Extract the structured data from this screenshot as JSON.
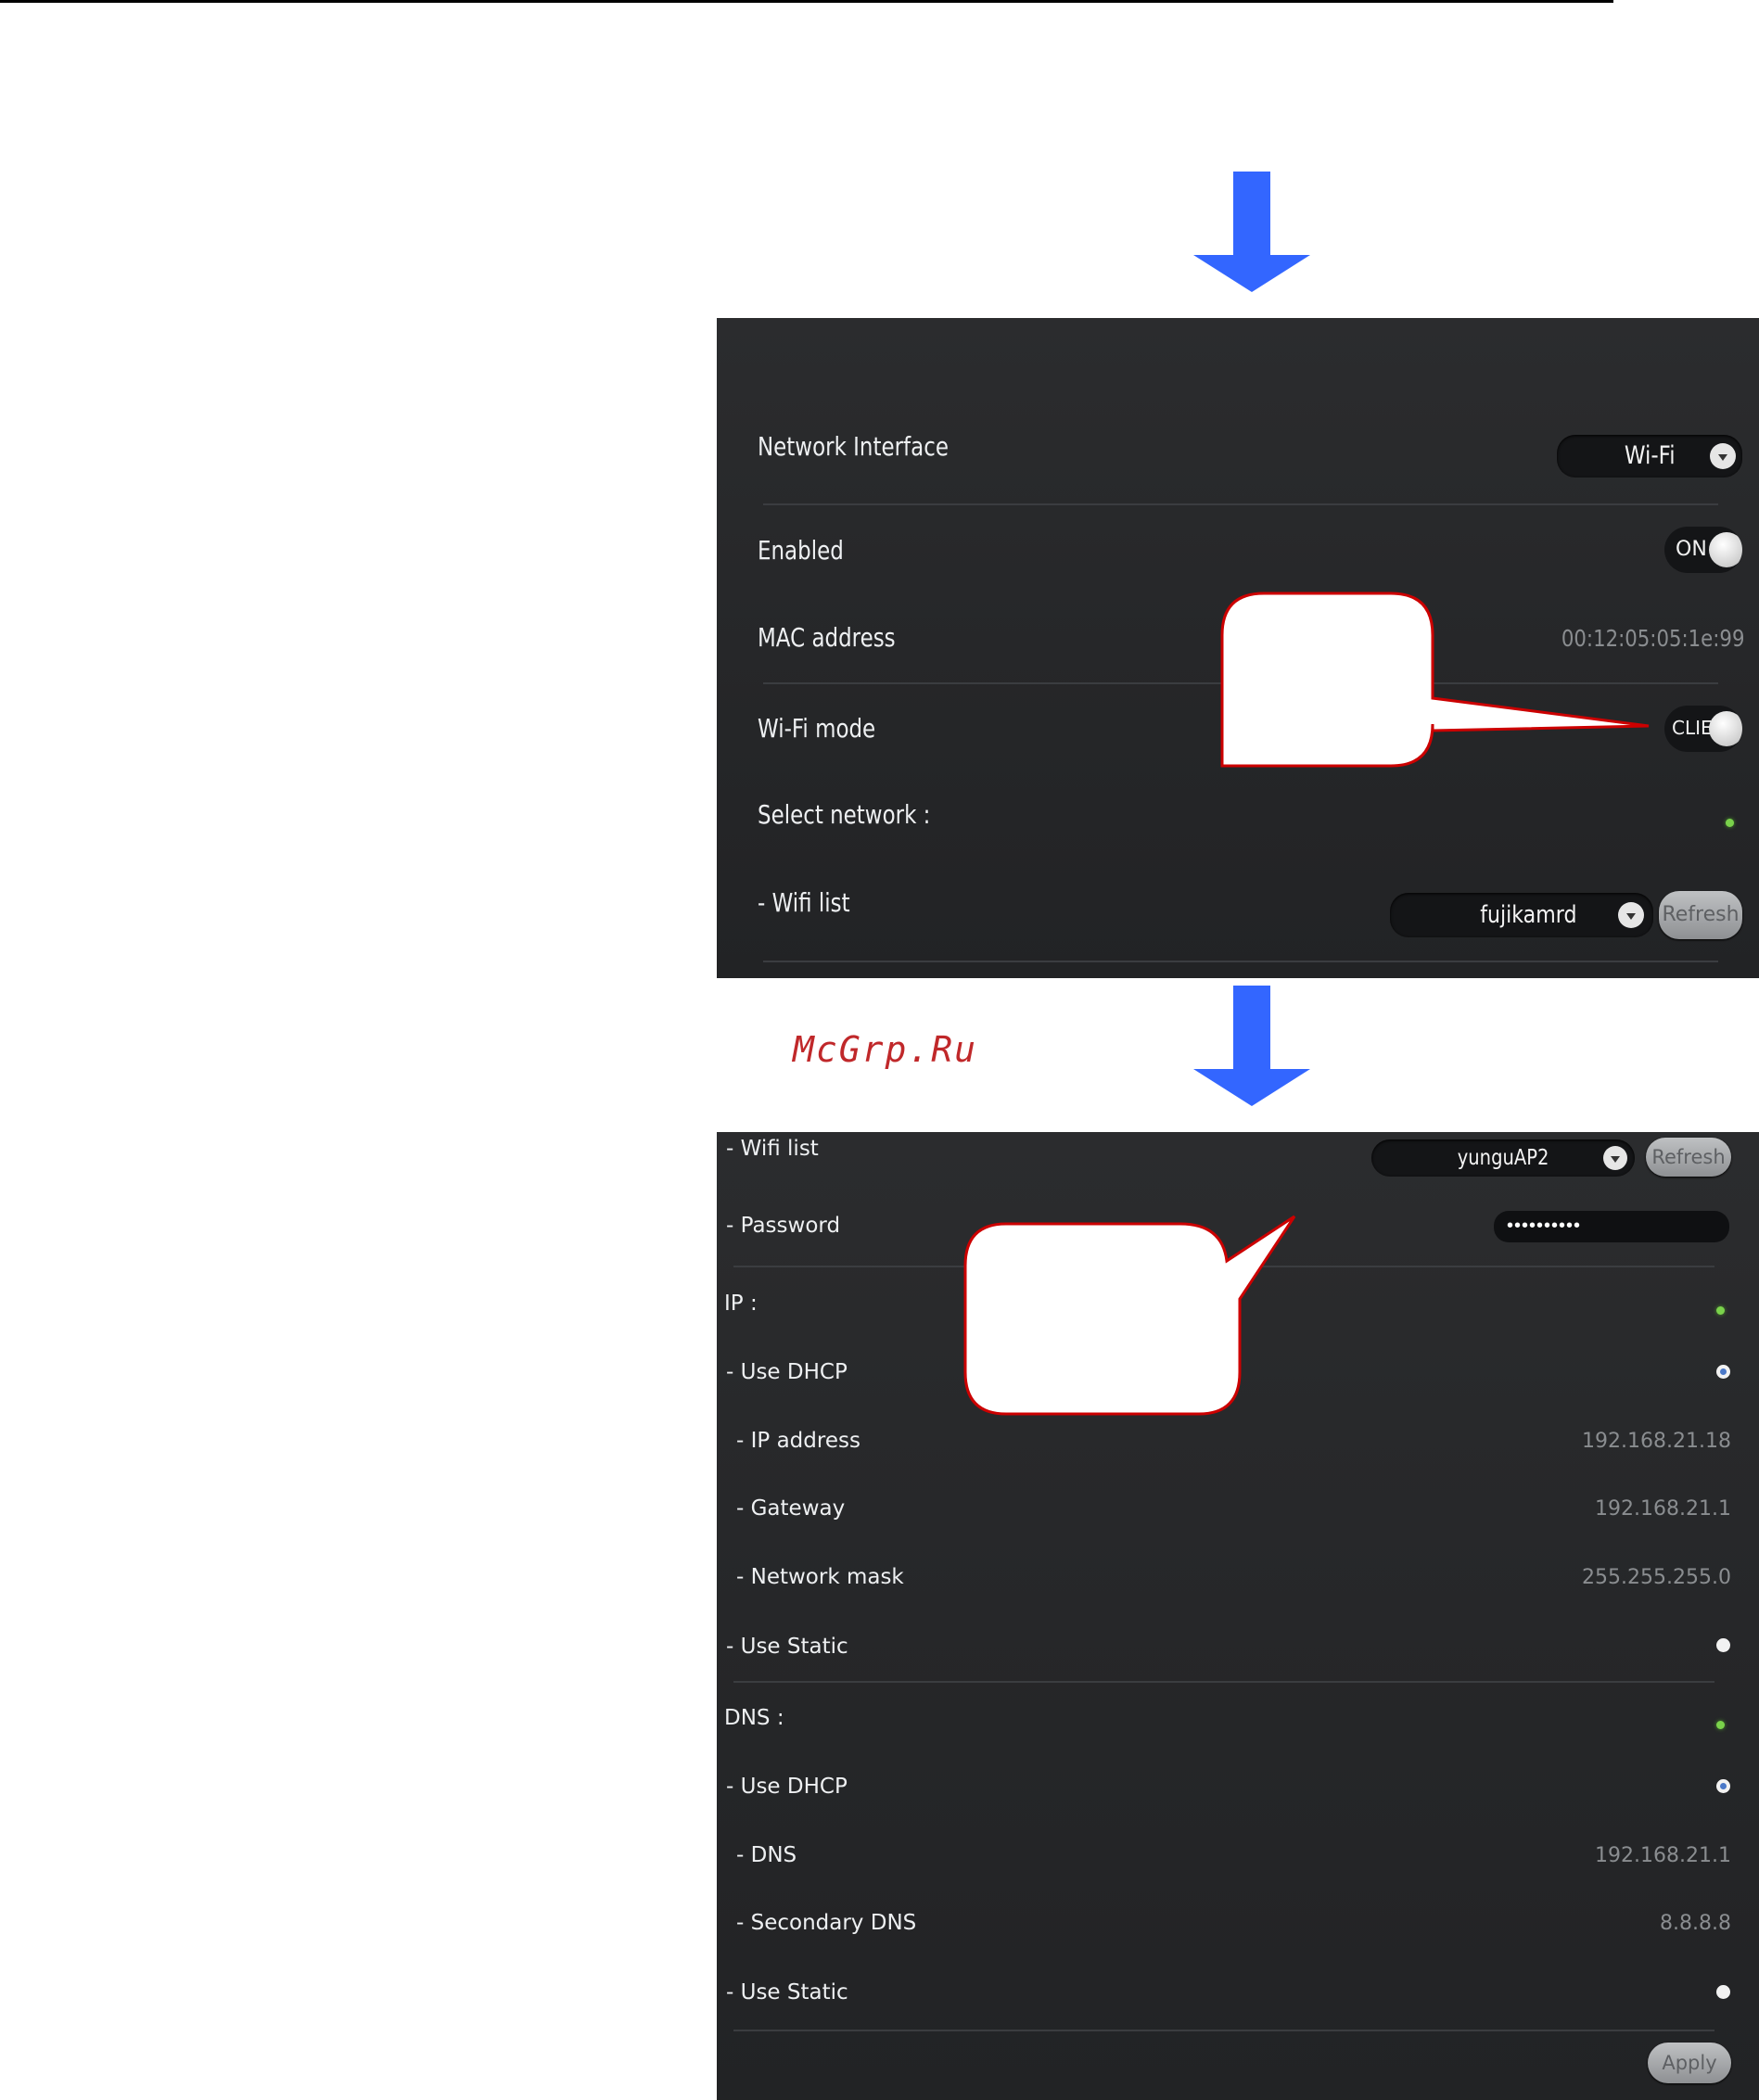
{
  "watermark": "McGrp.Ru",
  "panel_top": {
    "network_interface_label": "Network Interface",
    "network_interface_value": "Wi-Fi",
    "enabled_label": "Enabled",
    "enabled_value": "ON",
    "mac_label": "MAC address",
    "mac_value": "00:12:05:05:1e:99",
    "wifi_mode_label": "Wi-Fi mode",
    "wifi_mode_value": "CLIE",
    "select_network_label": "Select network :",
    "wifi_list_label": "- Wifi list",
    "wifi_list_value": "fujikamrd",
    "refresh_label": "Refresh"
  },
  "panel_bottom": {
    "wifi_list_label": "- Wifi list",
    "wifi_list_value": "yunguAP2",
    "refresh_label": "Refresh",
    "password_label": "- Password",
    "password_value": "••••••••••",
    "ip_label": "IP :",
    "use_dhcp_label": "- Use DHCP",
    "ip_address_label": "- IP address",
    "ip_address_value": "192.168.21.18",
    "gateway_label": "- Gateway",
    "gateway_value": "192.168.21.1",
    "netmask_label": "- Network mask",
    "netmask_value": "255.255.255.0",
    "use_static_label": "- Use Static",
    "dns_label": "DNS :",
    "dns_use_dhcp_label": "- Use DHCP",
    "dns1_label": "- DNS",
    "dns1_value": "192.168.21.1",
    "dns2_label": "- Secondary DNS",
    "dns2_value": "8.8.8.8",
    "dns_use_static_label": "- Use Static",
    "apply_label": "Apply"
  },
  "colors": {
    "arrow": "#3366ff",
    "callout_border": "#cc0000",
    "indicator": "#7ad24b"
  }
}
